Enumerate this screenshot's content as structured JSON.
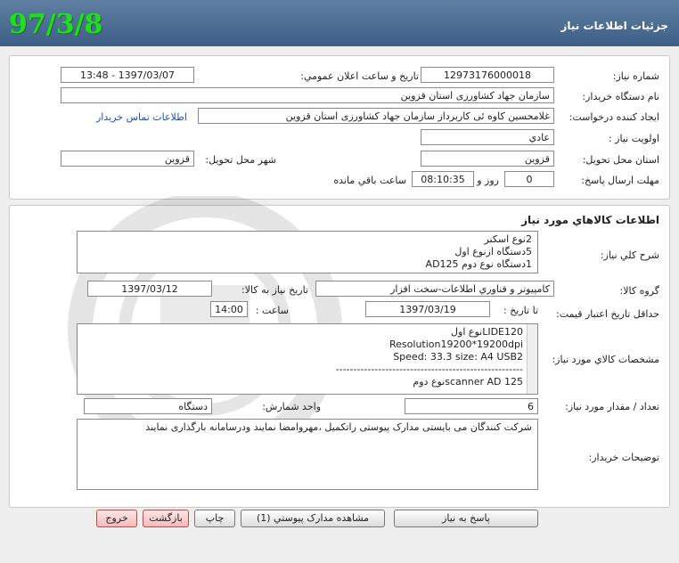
{
  "header": {
    "title": "جزئيات اطلاعات نياز",
    "date_stamp": "97/3/8"
  },
  "info": {
    "need_number_label": "شماره نياز:",
    "need_number": "12973176000018",
    "announce_label": "تاريخ و ساعت اعلان عمومي:",
    "announce_value": "1397/03/07 - 13:48",
    "buyer_org_label": "نام دستگاه خريدار:",
    "buyer_org": "سازمان جهاد کشاورزی استان قزوین",
    "requester_label": "ايجاد کننده درخواست:",
    "requester": "غلامحسین کاوه ئی کاربرداز سازمان جهاد کشاورزی استان قزوین",
    "contact_link": "اطلاعات تماس خريدار",
    "priority_label": "اولويت نياز :",
    "priority": "عادي",
    "province_label": "استان محل تحويل:",
    "province": "قزوين",
    "city_label": "شهر محل تحويل:",
    "city": "قزوين",
    "deadline_label": "مهلت ارسال پاسخ:",
    "days": "0",
    "days_label": "روز و",
    "time": "08:10:35",
    "remaining_label": "ساعت باقي مانده"
  },
  "goods": {
    "title": "اطلاعات کالاهاي مورد نياز",
    "summary_label": "شرح کلي نياز:",
    "summary_lines": [
      "2نوع اسکنر",
      "5دستگاه ازنوع اول",
      "1دستگاه نوع دوم AD125"
    ],
    "group_label": "گروه کالا:",
    "group": "کامپيوتر و فناوري اطلاعات-سخت افزار",
    "need_date_label": "تاريخ نياز به کالا:",
    "need_date": "1397/03/12",
    "validity_label": "حداقل تاريخ اعتبار قيمت:",
    "until_date_label": "تا تاريخ :",
    "until_date": "1397/03/19",
    "hour_label": "ساعت :",
    "hour": "14:00",
    "spec_label": "مشخصات کالاي مورد نياز:",
    "spec_lines": [
      "LIDE120نوع اول",
      "Resolution19200*19200dpi",
      "Speed: 33.3    size:  A4   USB2",
      "-----------------------------------------------------",
      "scanner AD 125نوع دوم"
    ],
    "qty_label": "تعداد / مقدار مورد نياز:",
    "qty": "6",
    "unit_label": "واحد شمارش:",
    "unit": "دستگاه",
    "buyer_notes_label": "توضيحات خريدار:",
    "buyer_notes": "شرکت کنندگان می بایستی مدارک پیوستی راتکمیل ،مهروامضا نمایند ودرسامانه بارگذاری نمایند"
  },
  "buttons": {
    "reply": "پاسخ به نياز",
    "view_docs": "مشاهده مدارک پيوستي (1)",
    "print": "چاپ",
    "back": "بازگشت",
    "exit": "خروج"
  }
}
